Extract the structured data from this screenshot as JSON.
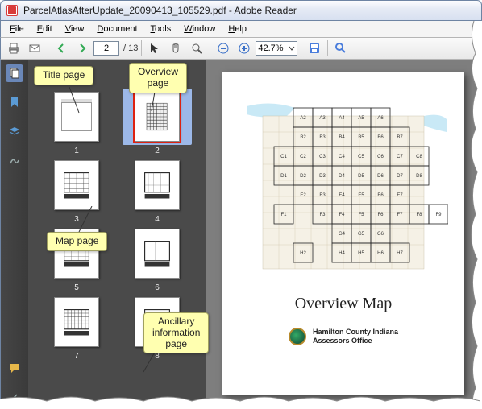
{
  "title": "ParcelAtlasAfterUpdate_20090413_105529.pdf - Adobe Reader",
  "menu": [
    "File",
    "Edit",
    "View",
    "Document",
    "Tools",
    "Window",
    "Help"
  ],
  "toolbar": {
    "page_value": "2",
    "page_count": "/ 13",
    "zoom": "42.7%"
  },
  "thumbs": [
    {
      "n": "1"
    },
    {
      "n": "2"
    },
    {
      "n": "3"
    },
    {
      "n": "4"
    },
    {
      "n": "5"
    },
    {
      "n": "6"
    },
    {
      "n": "7"
    },
    {
      "n": "8"
    }
  ],
  "selected_thumb": 2,
  "document": {
    "heading": "Overview Map",
    "org_line1": "Hamilton County Indiana",
    "org_line2": "Assessors Office",
    "grid_labels": {
      "rows": [
        "A",
        "B",
        "C",
        "D",
        "E",
        "F",
        "G",
        "H"
      ],
      "cols_per_row": {
        "A": [
          2,
          3,
          4,
          5,
          6
        ],
        "B": [
          2,
          3,
          4,
          5,
          6,
          7
        ],
        "C": [
          1,
          2,
          3,
          4,
          5,
          6,
          7,
          8
        ],
        "D": [
          1,
          2,
          3,
          4,
          5,
          6,
          7,
          8
        ],
        "E": [
          2,
          3,
          4,
          5,
          6,
          7
        ],
        "F": [
          1,
          3,
          4,
          5,
          6,
          7,
          8,
          9
        ],
        "G": [
          4,
          5,
          6
        ],
        "H": [
          2,
          4,
          5,
          6,
          7
        ]
      }
    }
  },
  "callouts": {
    "title_page": "Title page",
    "overview_page": "Overview\npage",
    "map_page": "Map page",
    "ancillary": "Ancillary\ninformation\npage"
  }
}
